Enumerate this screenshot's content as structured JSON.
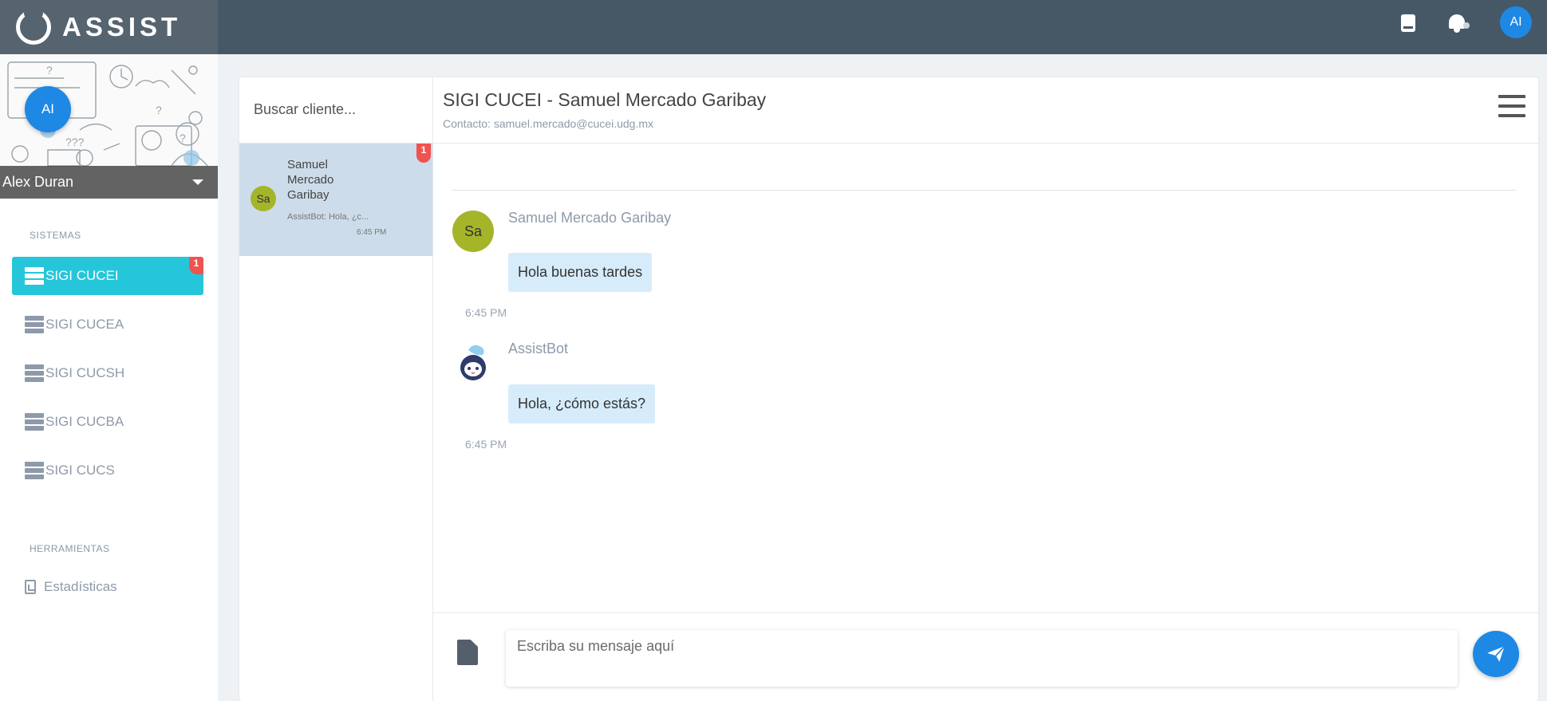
{
  "app": {
    "brand": "ASSIST",
    "user_initials": "AI"
  },
  "topbar": {
    "icons": [
      "book-icon",
      "bell-icon"
    ],
    "avatar": "AI"
  },
  "sidebar": {
    "profile": {
      "initials": "AI",
      "name": "Alex Duran"
    },
    "sections": [
      {
        "title": "SISTEMAS",
        "items": [
          {
            "label": "SIGI CUCEI",
            "active": true,
            "badge": "1"
          },
          {
            "label": "SIGI CUCEA"
          },
          {
            "label": "SIGI CUCSH"
          },
          {
            "label": "SIGI CUCBA"
          },
          {
            "label": "SIGI CUCS"
          }
        ]
      },
      {
        "title": "HERRAMIENTAS",
        "items": [
          {
            "label": "Estadísticas"
          }
        ]
      }
    ]
  },
  "contacts": {
    "search_placeholder": "Buscar cliente...",
    "items": [
      {
        "initials": "Sa",
        "name": "Samuel Mercado Garibay",
        "preview": "AssistBot: Hola, ¿c...",
        "time": "6:45 PM",
        "badge": "1"
      }
    ]
  },
  "chat": {
    "title": "SIGI CUCEI - Samuel Mercado Garibay",
    "subtitle": "Contacto: samuel.mercado@cucei.udg.mx",
    "messages": [
      {
        "sender": "Samuel Mercado Garibay",
        "initials": "Sa",
        "text": "Hola buenas tardes",
        "time": "6:45 PM"
      },
      {
        "sender": "AssistBot",
        "text": "Hola, ¿cómo estás?",
        "time": "6:45 PM"
      }
    ],
    "composer": {
      "placeholder": "Escriba su mensaje aquí"
    }
  },
  "colors": {
    "topbar": "#465866",
    "accent": "#26c6da",
    "primary": "#1e88e5",
    "badge": "#ef5350",
    "bubble": "#d7ecfb"
  }
}
